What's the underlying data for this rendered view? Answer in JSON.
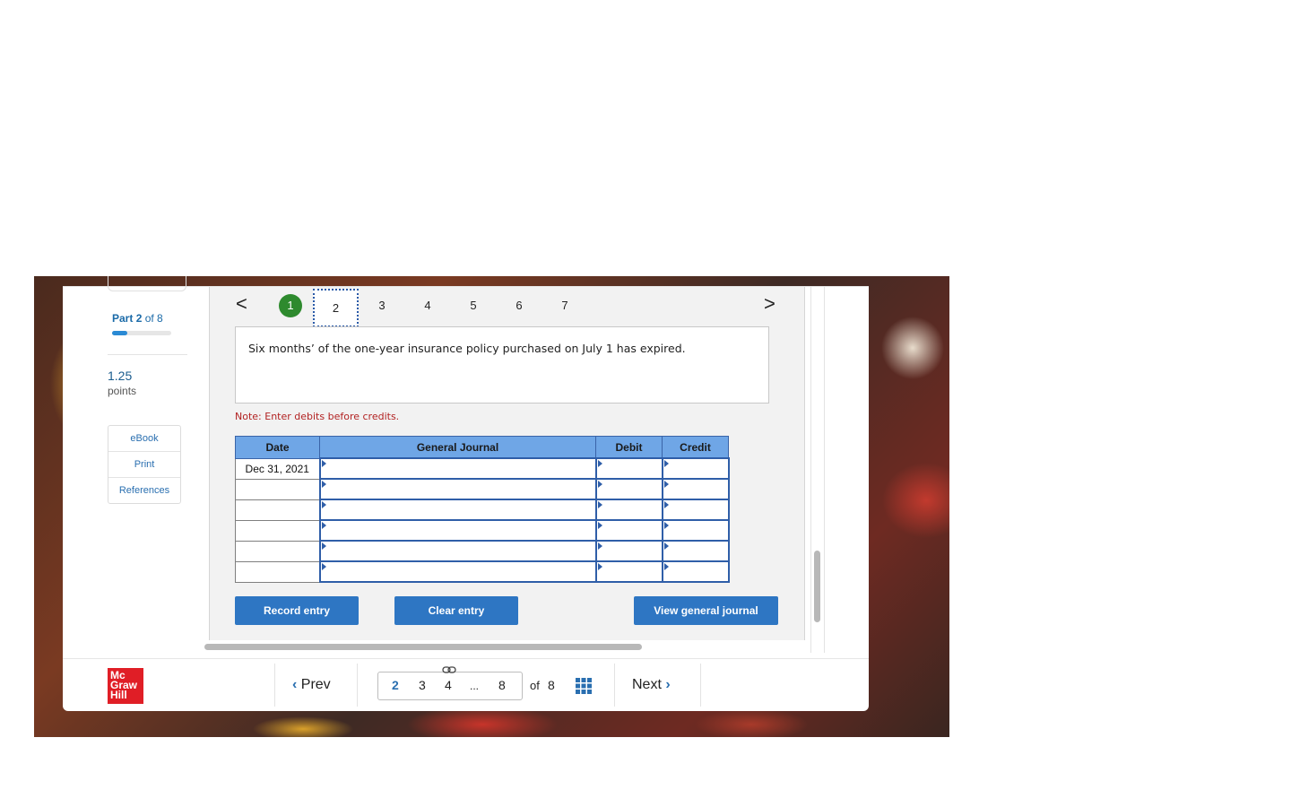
{
  "sidebar": {
    "part_prefix": "Part",
    "part_current": "2",
    "part_suffix": "of 8",
    "part_progress": 0.25,
    "points_value": "1.25",
    "points_label": "points",
    "links": [
      "eBook",
      "Print",
      "References"
    ]
  },
  "tabs": {
    "prev_glyph": "<",
    "next_glyph": ">",
    "items": [
      "1",
      "2",
      "3",
      "4",
      "5",
      "6",
      "7"
    ],
    "completed": "1",
    "current": "2"
  },
  "question": {
    "text": "Six months’ of the one-year insurance policy purchased on July 1 has expired.",
    "note": "Note: Enter debits before credits."
  },
  "journal": {
    "headers": {
      "date": "Date",
      "general_journal": "General Journal",
      "debit": "Debit",
      "credit": "Credit"
    },
    "rows": [
      {
        "date": "Dec 31, 2021",
        "account": "",
        "debit": "",
        "credit": ""
      },
      {
        "date": "",
        "account": "",
        "debit": "",
        "credit": ""
      },
      {
        "date": "",
        "account": "",
        "debit": "",
        "credit": ""
      },
      {
        "date": "",
        "account": "",
        "debit": "",
        "credit": ""
      },
      {
        "date": "",
        "account": "",
        "debit": "",
        "credit": ""
      },
      {
        "date": "",
        "account": "",
        "debit": "",
        "credit": ""
      }
    ]
  },
  "buttons": {
    "record": "Record entry",
    "clear": "Clear entry",
    "view": "View general journal"
  },
  "footer": {
    "logo_lines": [
      "Mc",
      "Graw",
      "Hill"
    ],
    "prev_label": "Prev",
    "next_label": "Next",
    "pages": [
      "2",
      "3",
      "4",
      "...",
      "8"
    ],
    "active_page": "2",
    "of_label": "of",
    "total_pages": "8"
  },
  "colors": {
    "accent_blue": "#2e76c3",
    "header_blue": "#6fa6e6",
    "completed_green": "#2e8a2e",
    "note_red": "#b22222",
    "logo_red": "#e01e26"
  }
}
